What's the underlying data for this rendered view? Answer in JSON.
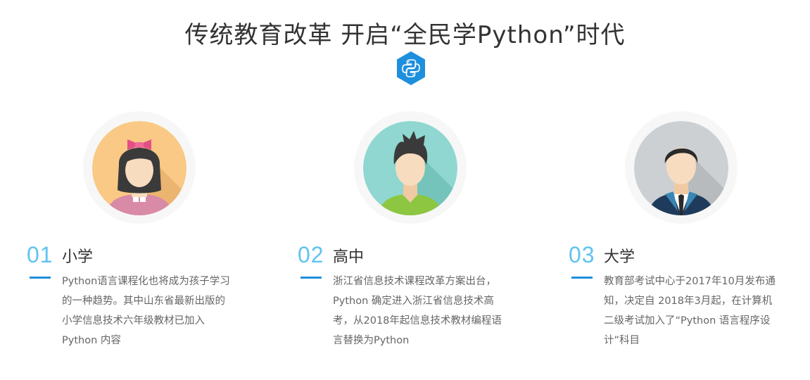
{
  "header": {
    "title": "传统教育改革  开启“全民学Python”时代",
    "logo_icon": "python-logo-icon",
    "logo_color": "#1e8fdd"
  },
  "stages": [
    {
      "number": "01",
      "level": "小学",
      "avatar_icon": "girl-avatar-icon",
      "avatar_bg": "#f9c985",
      "description_lines": [
        "Python语言课程化也将成为孩子学习",
        "的一种趋势。其中山东省最新出版的",
        "小学信息技术六年级教材已加入",
        "Python 内容"
      ]
    },
    {
      "number": "02",
      "level": "高中",
      "avatar_icon": "boy-avatar-icon",
      "avatar_bg": "#8fd7d0",
      "description_lines": [
        "浙江省信息技术课程改革方案出台，",
        "Python 确定进入浙江省信息技术高",
        "考，从2018年起信息技术教材编程语",
        "言替换为Python"
      ]
    },
    {
      "number": "03",
      "level": "大学",
      "avatar_icon": "man-in-suit-avatar-icon",
      "avatar_bg": "#cdd0d2",
      "description_lines": [
        "教育部考试中心于2017年10月发布通",
        "知，决定自 2018年3月起，在计算机",
        "二级考试加入了“Python 语言程序设",
        "计”科目"
      ]
    }
  ],
  "colors": {
    "number_color": "#5fc3f0",
    "dash_color": "#1e8fdd",
    "title_color": "#333333",
    "desc_color": "#666666"
  }
}
